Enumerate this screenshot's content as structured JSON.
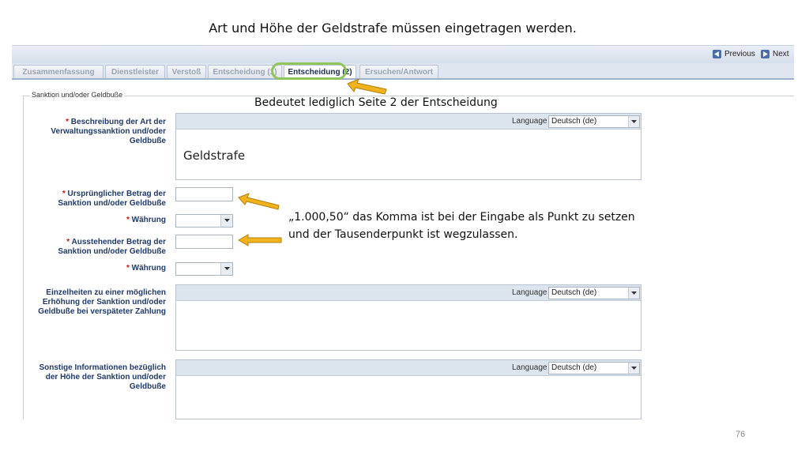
{
  "slide": {
    "title": "Art und Höhe der Geldstrafe müssen eingetragen werden.",
    "page_number": "76"
  },
  "toolbar": {
    "previous_label": "Previous",
    "next_label": "Next"
  },
  "tabs": [
    {
      "label": "Zusammenfassung",
      "active": false
    },
    {
      "label": "Dienstleister",
      "active": false
    },
    {
      "label": "Verstoß",
      "active": false
    },
    {
      "label": "Entscheidung (1)",
      "active": false
    },
    {
      "label": "Entscheidung (2)",
      "active": true
    },
    {
      "label": "Ersuchen/Antwort",
      "active": false
    }
  ],
  "section": {
    "legend": "Sanktion und/oder Geldbuße"
  },
  "fields": {
    "beschreibung": {
      "required": "*",
      "label": "Beschreibung der Art der Verwaltungssanktion und/oder Geldbuße",
      "language_label": "Language",
      "language_value": "Deutsch (de)",
      "value": "Geldstrafe"
    },
    "urspruenglicher_betrag": {
      "required": "*",
      "label": "Ursprünglicher Betrag der Sanktion und/oder Geldbuße",
      "value": ""
    },
    "waehrung1": {
      "required": "*",
      "label": "Währung",
      "value": ""
    },
    "ausstehender_betrag": {
      "required": "*",
      "label": "Ausstehender Betrag der Sanktion und/oder Geldbuße",
      "value": ""
    },
    "waehrung2": {
      "required": "*",
      "label": "Währung",
      "value": ""
    },
    "einzelheiten": {
      "label": "Einzelheiten zu einer möglichen Erhöhung der Sanktion und/oder Geldbuße bei verspäteter Zahlung",
      "language_label": "Language",
      "language_value": "Deutsch (de)",
      "value": ""
    },
    "sonstige": {
      "label": "Sonstige Informationen bezüglich der Höhe der Sanktion und/oder Geldbuße",
      "language_label": "Language",
      "language_value": "Deutsch (de)",
      "value": ""
    }
  },
  "annotations": {
    "tab_note": "Bedeutet lediglich Seite 2 der Entscheidung",
    "amount_note_line1": "„1.000,50“ das Komma ist bei der Eingabe als Punkt zu setzen",
    "amount_note_line2": "und der Tausenderpunkt ist wegzulassen.",
    "arrow_color": "#f2b21b",
    "highlight_color": "#8ec65a"
  }
}
